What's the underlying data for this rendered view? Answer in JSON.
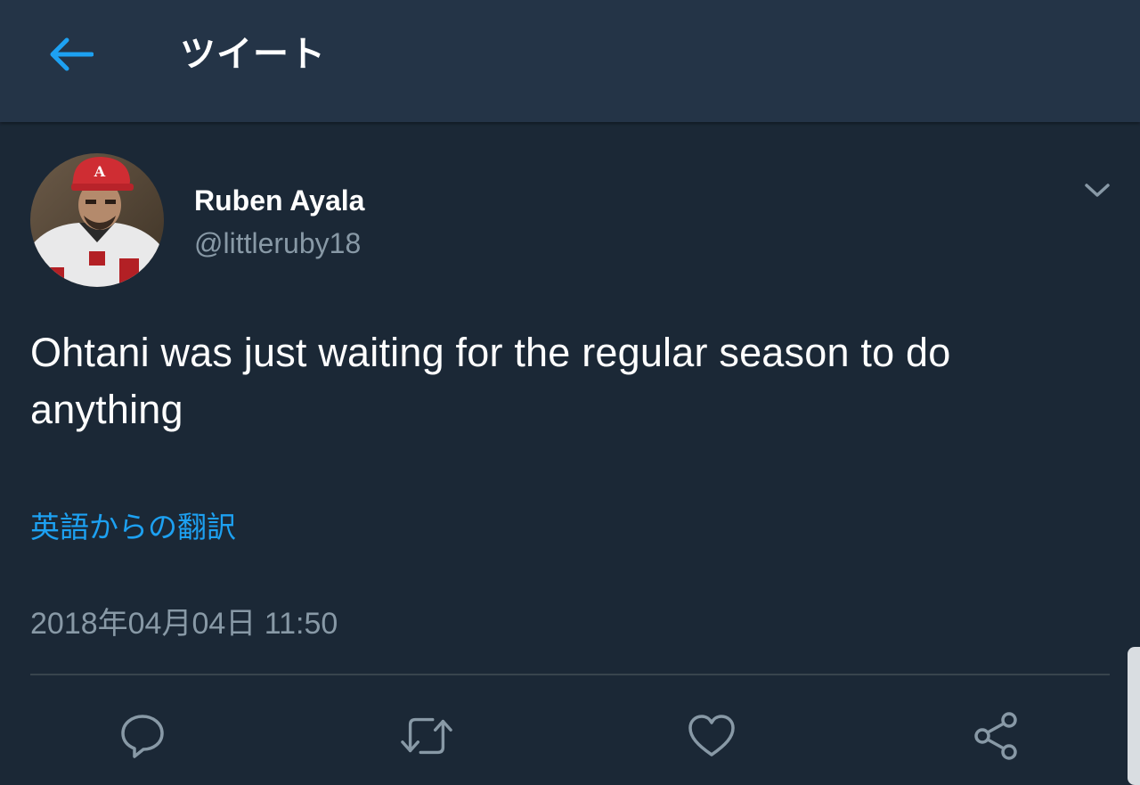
{
  "header": {
    "title": "ツイート",
    "back_icon": "arrow-left-icon"
  },
  "tweet": {
    "author": {
      "name": "Ruben Ayala",
      "handle": "@littleruby18"
    },
    "text": "Ohtani was just waiting for the regular season to do anything",
    "translate_label": "英語からの翻訳",
    "timestamp": "2018年04月04日 11:50"
  },
  "actions": [
    "reply-icon",
    "retweet-icon",
    "like-icon",
    "share-icon"
  ],
  "colors": {
    "background": "#1b2836",
    "header": "#243447",
    "accent": "#1da1f2",
    "secondary_text": "#8899a6",
    "divider": "#38444d"
  }
}
